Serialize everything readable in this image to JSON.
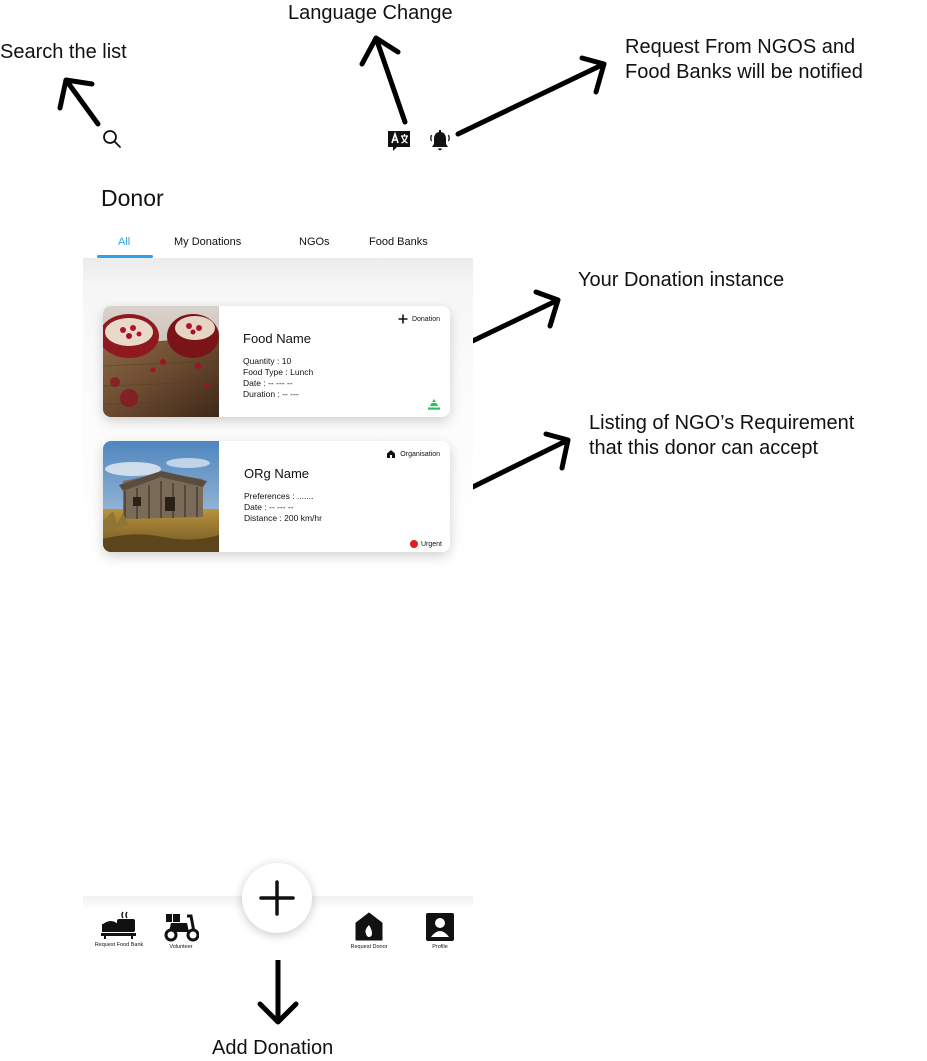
{
  "annotations": {
    "search": "Search the list",
    "language": "Language Change",
    "requests": [
      "Request From NGOS and",
      "Food Banks will be notified"
    ],
    "donation_instance": "Your Donation instance",
    "ngo_listing": [
      "Listing of NGO’s Requirement",
      "that this donor can accept"
    ],
    "add_donation": "Add Donation"
  },
  "header": {
    "title": "Donor",
    "icons": [
      "search-icon",
      "translate-icon",
      "bell-icon"
    ]
  },
  "tabs": [
    {
      "label": "All",
      "active": true
    },
    {
      "label": "My Donations",
      "active": false
    },
    {
      "label": "NGOs",
      "active": false
    },
    {
      "label": "Food Banks",
      "active": false
    }
  ],
  "cards": {
    "donation": {
      "tag": "Donation",
      "title": "Food Name",
      "lines": [
        "Quantity : 10",
        "Food Type : Lunch",
        "Date : -- --- --",
        "Duration : -- ---"
      ],
      "status_icon": "triangle-stack-icon",
      "status_color": "#22c55e"
    },
    "organisation": {
      "tag": "Organisation",
      "title": "ORg Name",
      "lines": [
        "Preferences : .......",
        "Date : -- --- --",
        "Distance : 200 km/hr"
      ],
      "badge": "Urgent",
      "badge_color": "#e11d1d"
    }
  },
  "bottom_nav": {
    "items": [
      {
        "label": "Request Food Bank",
        "icon": "food-bank-icon"
      },
      {
        "label": "Volunteer",
        "icon": "scooter-icon"
      },
      {
        "label": "Request Donor",
        "icon": "house-flame-icon"
      },
      {
        "label": "Profile",
        "icon": "profile-icon"
      }
    ],
    "fab_icon": "plus-icon"
  },
  "colors": {
    "accent": "#2aa3ee",
    "urgent": "#e11d1d",
    "success": "#22c55e"
  }
}
